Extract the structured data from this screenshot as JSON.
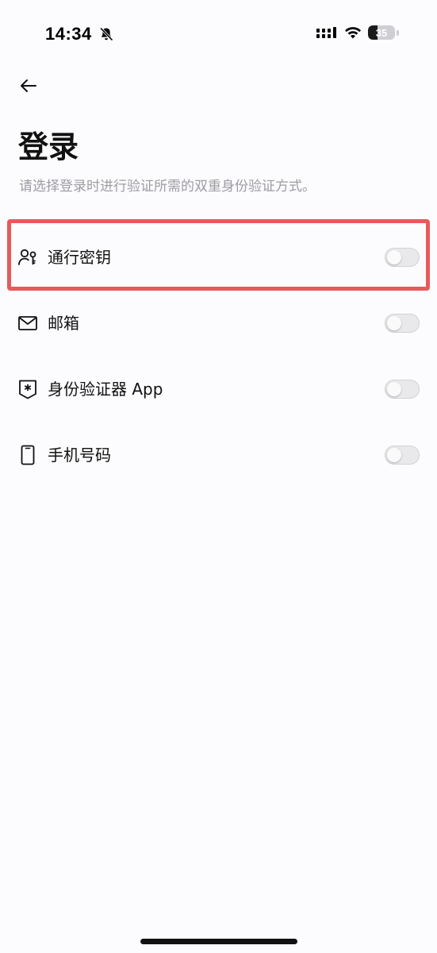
{
  "status_bar": {
    "time": "14:34",
    "battery_level": "35",
    "battery_fraction": 0.35,
    "bell_icon": "bell-slash-icon",
    "signal_icon": "cellular-signal-icon",
    "wifi_icon": "wifi-icon"
  },
  "header": {
    "back_icon": "arrow-left-icon",
    "title": "登录",
    "subtitle": "请选择登录时进行验证所需的双重身份验证方式。"
  },
  "options": [
    {
      "label": "通行密钥",
      "icon": "passkey-person-icon",
      "enabled": false,
      "highlighted": true
    },
    {
      "label": "邮箱",
      "icon": "mail-icon",
      "enabled": false,
      "highlighted": false
    },
    {
      "label": "身份验证器 App",
      "icon": "authenticator-shield-icon",
      "enabled": false,
      "highlighted": false
    },
    {
      "label": "手机号码",
      "icon": "phone-icon",
      "enabled": false,
      "highlighted": false
    }
  ],
  "colors": {
    "background": "#fcfbfd",
    "highlight": "#e8595d",
    "subtitle": "#9c9ca3",
    "toggle_off": "#e9e9ec"
  }
}
